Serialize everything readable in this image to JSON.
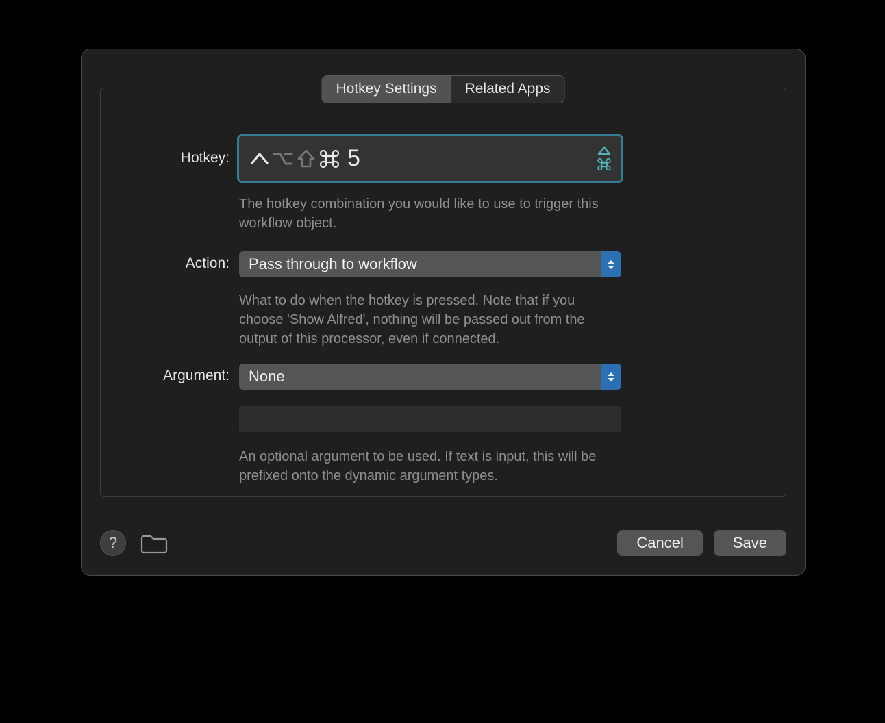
{
  "tabs": {
    "settings": "Hotkey Settings",
    "related": "Related Apps",
    "active": "settings"
  },
  "hotkey": {
    "label": "Hotkey:",
    "modifiers": {
      "control": true,
      "option": false,
      "shift": false,
      "command": true
    },
    "key": "5",
    "help": "The hotkey combination you would like to use to trigger this workflow object.",
    "clear_icon": "eject-cmd-icon",
    "focus_color": "#347e97"
  },
  "action": {
    "label": "Action:",
    "value": "Pass through to workflow",
    "help": "What to do when the hotkey is pressed. Note that if you choose 'Show Alfred', nothing will be passed out from the output of this processor, even if connected."
  },
  "argument": {
    "label": "Argument:",
    "value": "None",
    "text_value": "",
    "help": "An optional argument to be used. If text is input, this will be prefixed onto the dynamic argument types."
  },
  "footer": {
    "help_tooltip": "?",
    "cancel": "Cancel",
    "save": "Save"
  },
  "colors": {
    "accent_teal": "#4fb5b8",
    "select_cap": "#2d6fb3"
  }
}
